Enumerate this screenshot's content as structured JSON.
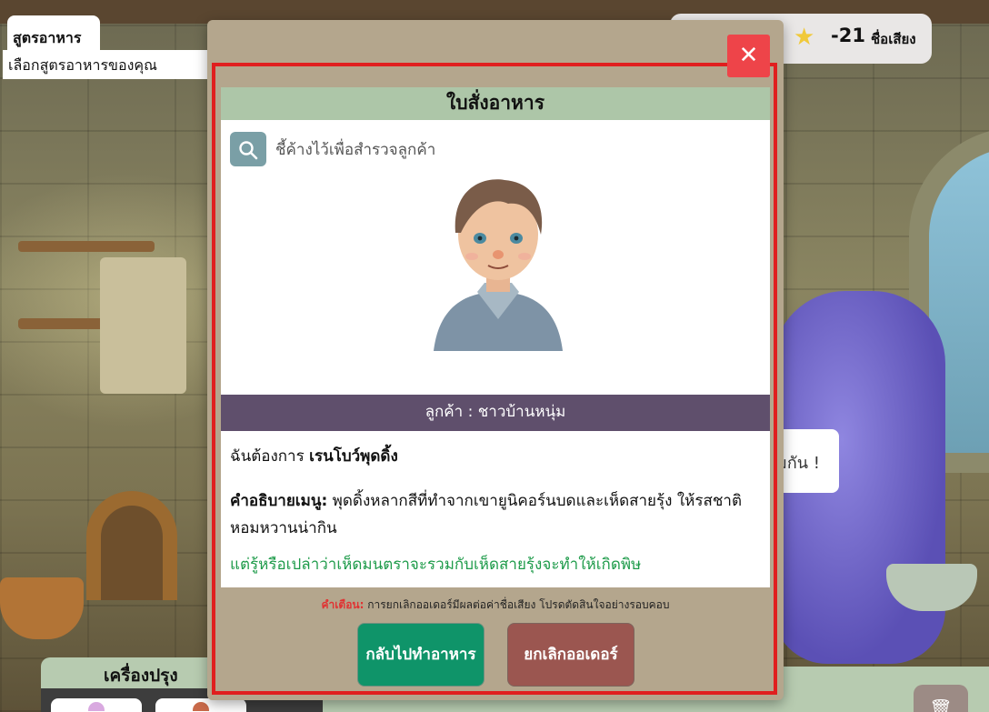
{
  "recipe": {
    "title": "สูตรอาหาร",
    "subtitle": "เลือกสูตรอาหารของคุณ"
  },
  "reputation": {
    "value": "-21",
    "label": "ชื่อเสียง",
    "icon": "star-icon"
  },
  "speech": {
    "text": "มกัน !"
  },
  "cookware": {
    "title": "เครื่องปรุง"
  },
  "order": {
    "title": "ใบสั่งอาหาร",
    "hint": "ชี้ค้างไว้เพื่อสำรวจลูกค้า",
    "customer": "ลูกค้า : ชาวบ้านหนุ่ม",
    "want_prefix": "ฉันต้องการ",
    "dish": "เรนโบว์พุดดิ้ง",
    "desc_label": "คำอธิบายเมนู:",
    "desc_text": "พุดดิ้งหลากสีที่ทำจากเขายูนิคอร์นบดและเห็ดสายรุ้ง ให้รสชาติหอมหวานน่ากิน",
    "secret": "แต่รู้หรือเปล่าว่าเห็ดมนตราจะรวมกับเห็ดสายรุ้งจะทำให้เกิดพิษ",
    "warning_label": "คำเตือน:",
    "warning_text": "การยกเลิกออเดอร์มีผลต่อค่าชื่อเสียง โปรดตัดสินใจอย่างรอบคอบ",
    "back_button": "กลับไปทำอาหาร",
    "cancel_button": "ยกเลิกออเดอร์",
    "close_icon": "close-icon"
  },
  "colors": {
    "header_green": "#adc6a8",
    "customer_bar": "#5f4f6c",
    "back_button": "#0f9469",
    "cancel_button": "#9b5650",
    "secret_text": "#1e9b4a",
    "warning_label": "#e03333",
    "close_button": "#ee4449"
  }
}
